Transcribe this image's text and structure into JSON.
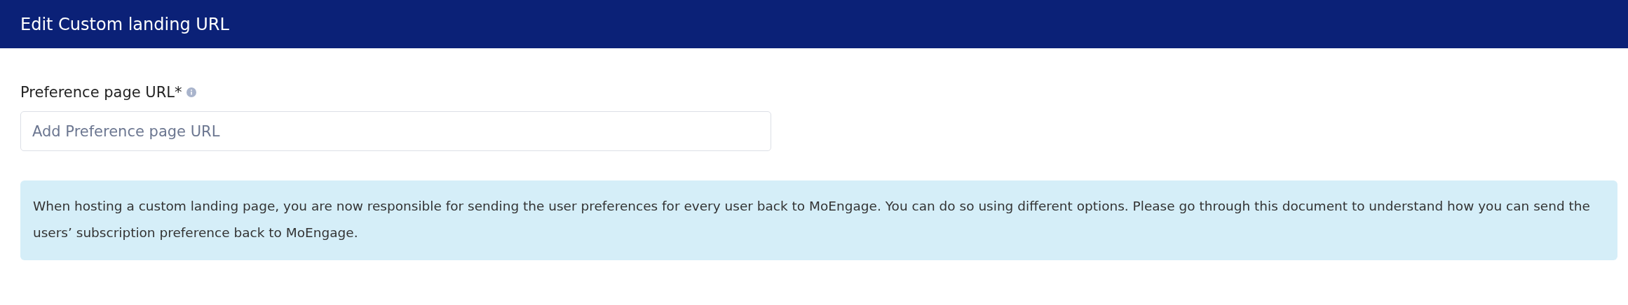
{
  "header": {
    "title": "Edit Custom landing URL"
  },
  "field": {
    "label": "Preference page URL*",
    "placeholder": "Add Preference page URL"
  },
  "notice": {
    "text": "When hosting a custom landing page, you are now responsible for sending the user preferences for every user back to MoEngage. You can do so using different options. Please go through this document to understand how you can send the users’ subscription preference back to MoEngage."
  }
}
